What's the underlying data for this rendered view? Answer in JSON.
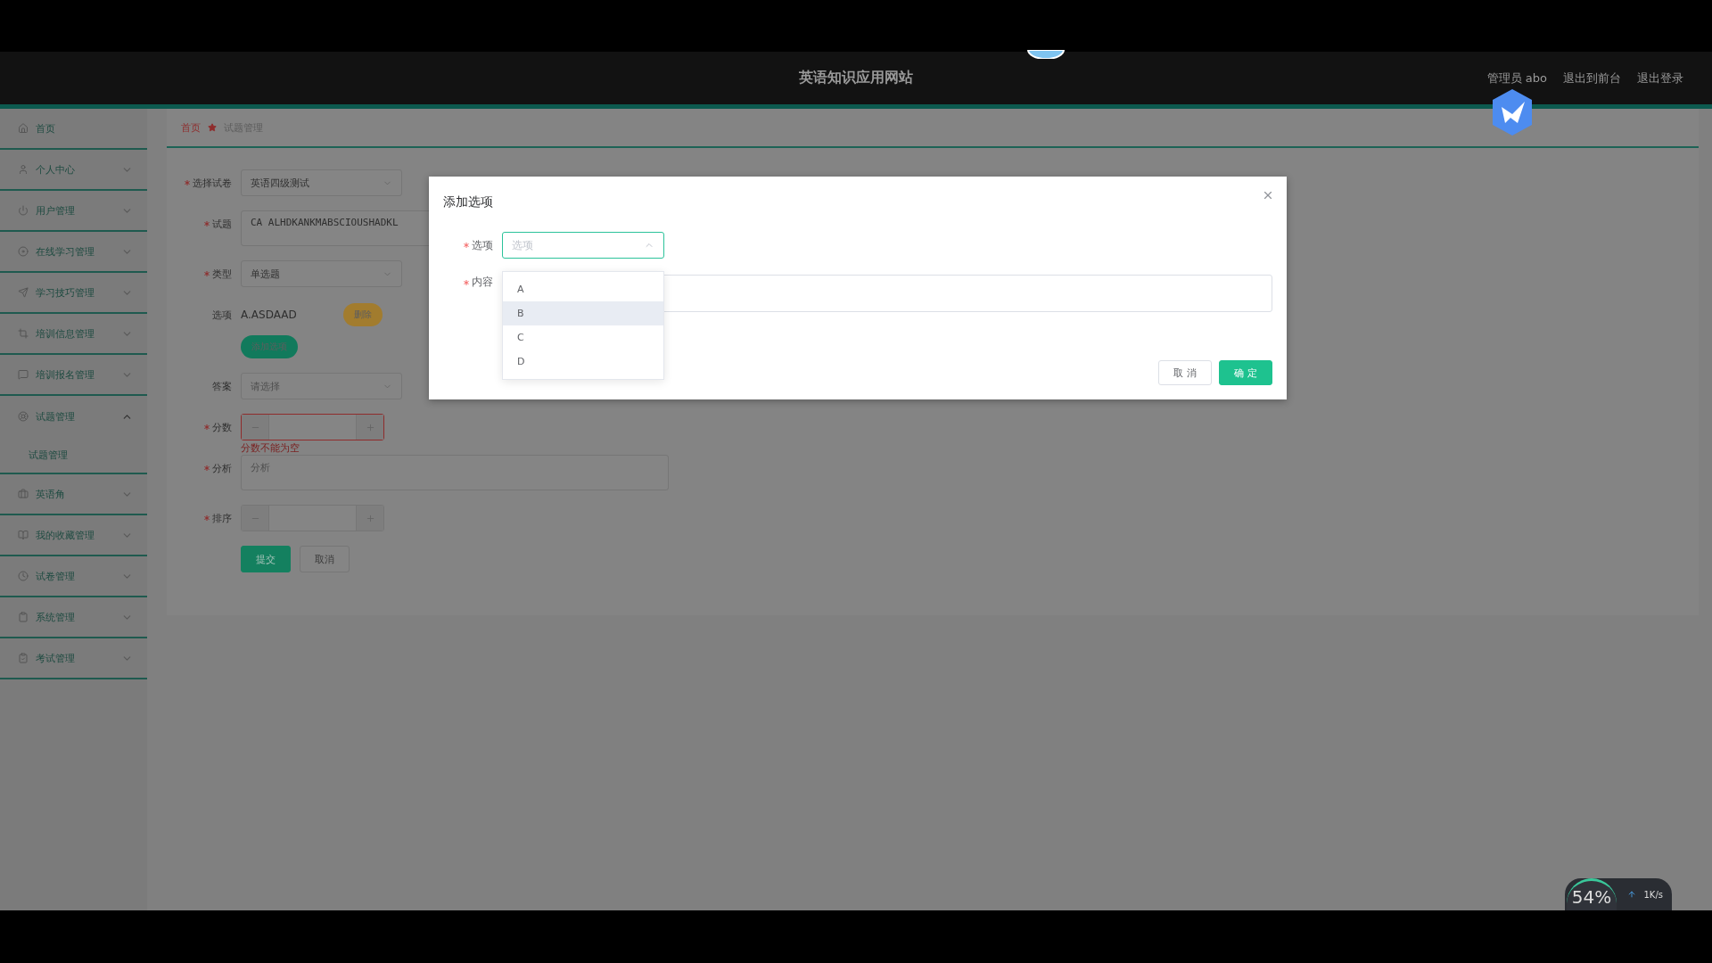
{
  "header": {
    "title": "英语知识应用网站",
    "links": [
      "管理员 abo",
      "退出到前台",
      "退出登录"
    ]
  },
  "sidebar": {
    "items": [
      {
        "label": "首页"
      },
      {
        "label": "个人中心",
        "expanded": false
      },
      {
        "label": "用户管理",
        "expanded": false
      },
      {
        "label": "在线学习管理",
        "expanded": false
      },
      {
        "label": "学习技巧管理",
        "expanded": false
      },
      {
        "label": "培训信息管理",
        "expanded": false
      },
      {
        "label": "培训报名管理",
        "expanded": false
      },
      {
        "label": "试题管理",
        "expanded": true,
        "children": [
          {
            "label": "试题管理"
          }
        ]
      },
      {
        "label": "英语角",
        "expanded": false
      },
      {
        "label": "我的收藏管理",
        "expanded": false
      },
      {
        "label": "试卷管理",
        "expanded": false
      },
      {
        "label": "系统管理",
        "expanded": false
      },
      {
        "label": "考试管理",
        "expanded": false
      }
    ]
  },
  "breadcrumb": {
    "home": "首页",
    "current": "试题管理"
  },
  "form": [
    {
      "kind": "select",
      "label": "选择试卷",
      "required": true,
      "value": "英语四级测试"
    },
    {
      "kind": "textarea",
      "label": "试题",
      "required": true,
      "value": "CA ALHDKANKMABSCIOUSHADKL"
    },
    {
      "kind": "select",
      "label": "类型",
      "required": true,
      "value": "单选题"
    },
    {
      "kind": "option",
      "label": "选项",
      "required": false,
      "value": "A.ASDAAD",
      "button": "删除"
    },
    {
      "kind": "add",
      "label": "添加选项"
    },
    {
      "kind": "select",
      "label": "答案",
      "required": false,
      "placeholder": "请选择"
    },
    {
      "kind": "number",
      "label": "分数",
      "required": true,
      "error": "分数不能为空"
    },
    {
      "kind": "textarea",
      "label": "分析",
      "required": true,
      "placeholder": "分析"
    },
    {
      "kind": "number",
      "label": "排序",
      "required": true
    }
  ],
  "actions": [
    {
      "label": "提交",
      "kind": "primary"
    },
    {
      "label": "取消",
      "kind": "default"
    }
  ],
  "dialog": {
    "title": "添加选项",
    "fields": [
      {
        "label": "选项",
        "required": true,
        "placeholder": "选项",
        "expanded": true
      },
      {
        "label": "内容",
        "required": true
      }
    ],
    "dropdown": [
      {
        "label": "A",
        "hovered": false
      },
      {
        "label": "B",
        "hovered": true
      },
      {
        "label": "C",
        "hovered": false
      },
      {
        "label": "D",
        "hovered": false
      }
    ],
    "buttons": [
      {
        "label": "取 消",
        "kind": "default"
      },
      {
        "label": "确 定",
        "kind": "primary"
      }
    ]
  },
  "speed_widget": {
    "percent": "54%",
    "rate": "1K/s"
  }
}
